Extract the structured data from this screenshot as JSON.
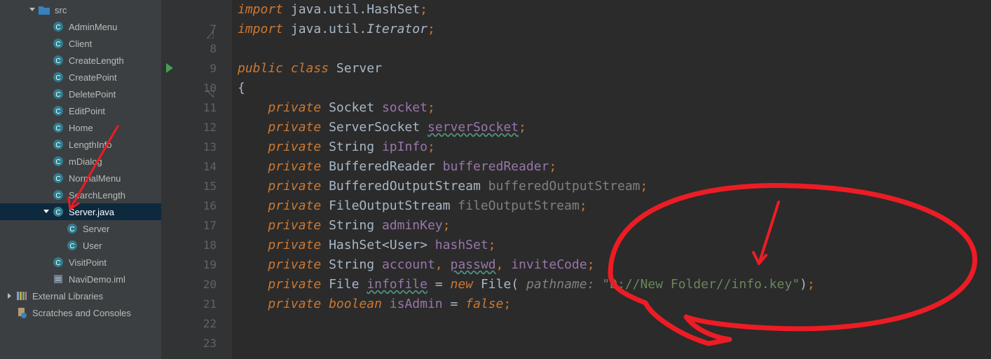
{
  "tree": {
    "src": "src",
    "adminMenu": "AdminMenu",
    "client": "Client",
    "createLength": "CreateLength",
    "createPoint": "CreatePoint",
    "deletePoint": "DeletePoint",
    "editPoint": "EditPoint",
    "home": "Home",
    "lengthInfo": "LengthInfo",
    "mDialog": "mDialog",
    "normalMenu": "NormalMenu",
    "searchLength": "SearchLength",
    "serverJava": "Server.java",
    "serverClass": "Server",
    "userClass": "User",
    "visitPoint": "VisitPoint",
    "naviDemo": "NaviDemo.iml",
    "externalLibs": "External Libraries",
    "scratches": "Scratches and Consoles"
  },
  "gutter": {
    "l6": "",
    "l7": "7",
    "l8": "8",
    "l9": "9",
    "l10": "10",
    "l11": "11",
    "l12": "12",
    "l13": "13",
    "l14": "14",
    "l15": "15",
    "l16": "16",
    "l17": "17",
    "l18": "18",
    "l19": "19",
    "l20": "20",
    "l21": "21",
    "l22": "22",
    "l23": "23"
  },
  "code": {
    "l6": {
      "kw": "import",
      "pkg": " java.util.HashSet",
      "semi": ";"
    },
    "l7": {
      "kw": "import",
      "pkg": " java.util.",
      "cls": "Iterator",
      "semi": ";"
    },
    "l9": {
      "pub": "public",
      "cls": "class",
      "name": "Server"
    },
    "l10": {
      "brace": "{"
    },
    "l11": {
      "kw": "private",
      "type": "Socket",
      "field": "socket",
      "semi": ";"
    },
    "l12": {
      "kw": "private",
      "type": "ServerSocket",
      "field": "serverSocket",
      "semi": ";"
    },
    "l13": {
      "kw": "private",
      "type": "String",
      "field": "ipInfo",
      "semi": ";"
    },
    "l14": {
      "kw": "private",
      "type": "BufferedReader",
      "field": "bufferedReader",
      "semi": ";"
    },
    "l15": {
      "kw": "private",
      "type": "BufferedOutputStream",
      "field": "bufferedOutputStream",
      "semi": ";"
    },
    "l16": {
      "kw": "private",
      "type": "FileOutputStream",
      "field": "fileOutputStream",
      "semi": ";"
    },
    "l17": {
      "kw": "private",
      "type": "String",
      "field": "adminKey",
      "semi": ";"
    },
    "l18": {
      "kw": "private",
      "type": "HashSet",
      "gen": "<User>",
      "field": "hashSet",
      "semi": ";"
    },
    "l19": {
      "kw": "private",
      "type": "String",
      "f1": "account",
      "c1": ", ",
      "f2": "passwd",
      "c2": ", ",
      "f3": "inviteCode",
      "semi": ";"
    },
    "l20": {
      "kw": "private",
      "type": "File",
      "field": "infofile",
      "eq": " = ",
      "new": "new",
      "newType": "File",
      "open": "( ",
      "paramName": "pathname: ",
      "str": "\"D://New Folder//info.key\"",
      "close": ")",
      "semi": ";"
    },
    "l21": {
      "kw": "private",
      "type": "boolean",
      "field": "isAdmin",
      "eq": " = ",
      "false": "false",
      "semi": ";"
    }
  }
}
